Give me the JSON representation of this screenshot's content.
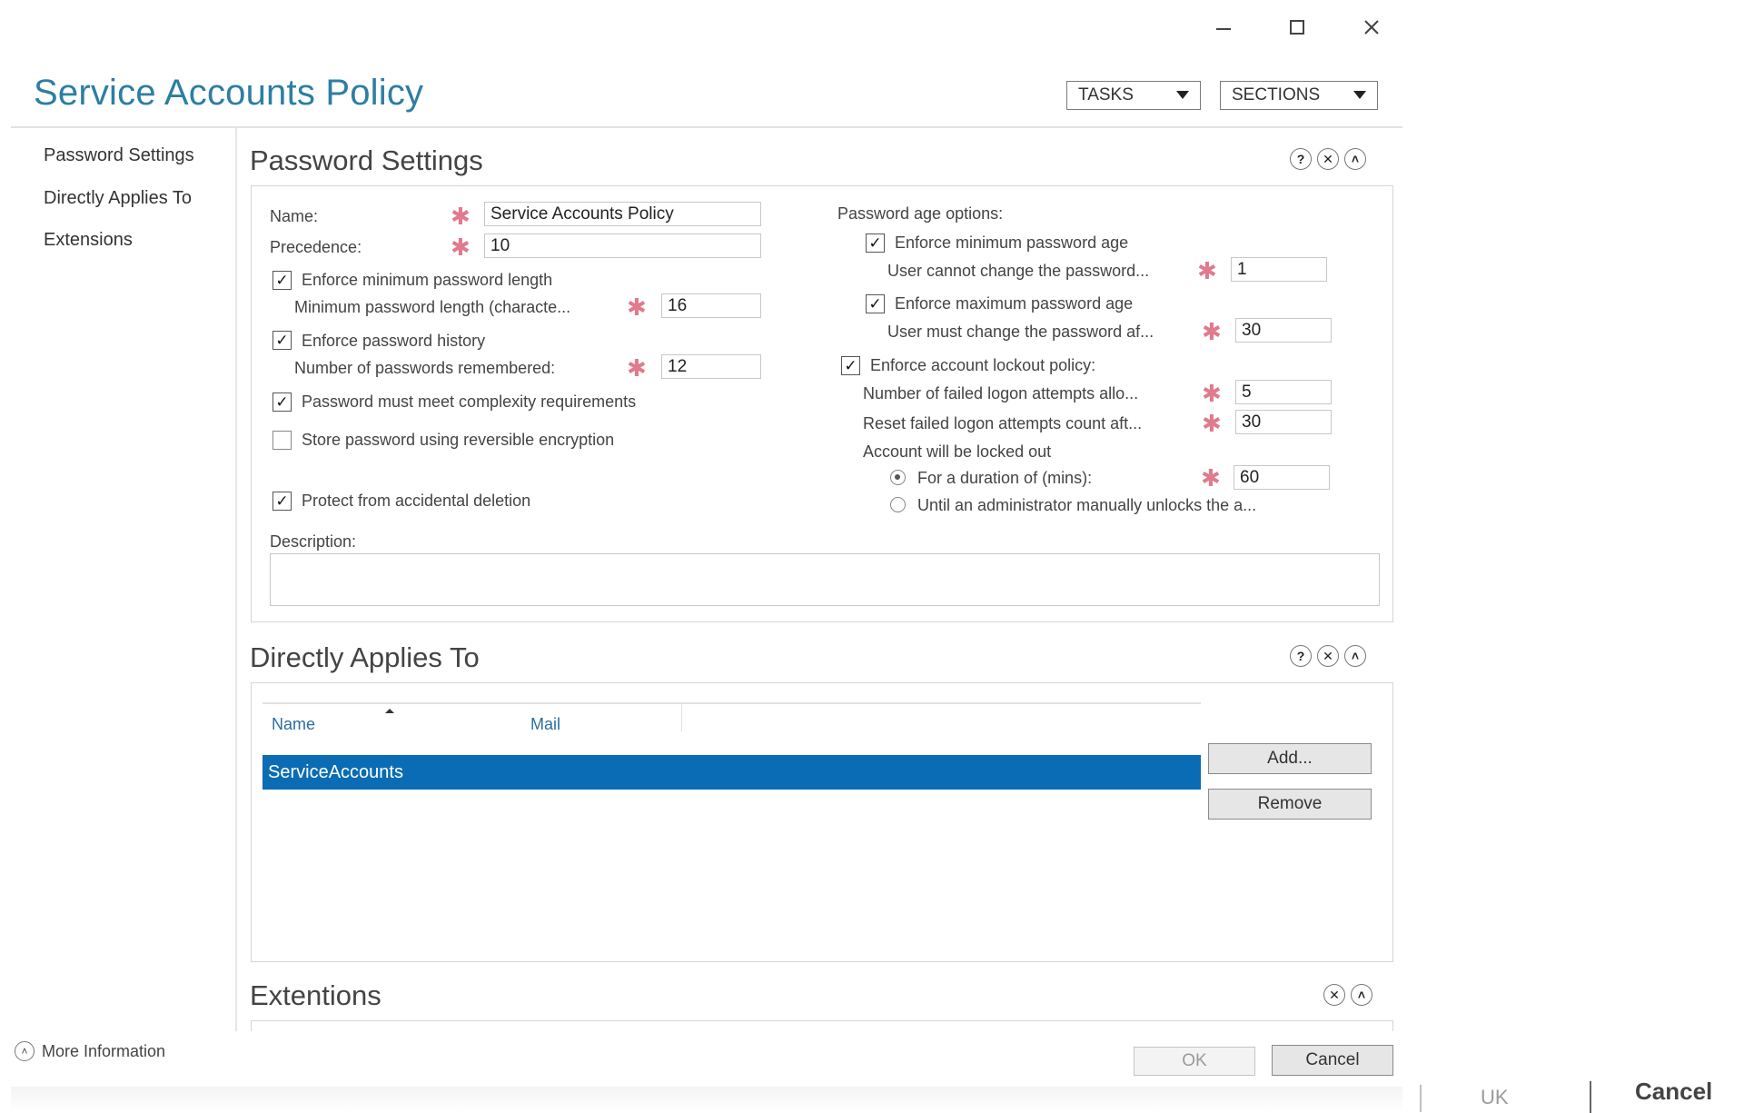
{
  "window": {
    "minimize_icon": "minimize-icon",
    "maximize_icon": "maximize-icon",
    "close_icon": "close-icon"
  },
  "app_title": "Service Accounts Policy",
  "header": {
    "tasks_label": "TASKS",
    "sections_label": "SECTIONS"
  },
  "nav": {
    "items": [
      "Password Settings",
      "Directly Applies To",
      "Extensions"
    ]
  },
  "password_settings": {
    "title": "Password Settings",
    "name_label": "Name:",
    "name_value": "Service Accounts Policy",
    "precedence_label": "Precedence:",
    "precedence_value": "10",
    "enforce_min_len_label": "Enforce minimum password length",
    "enforce_min_len_checked": true,
    "min_len_label": "Minimum password length (characte...",
    "min_len_value": "16",
    "enforce_history_label": "Enforce password history",
    "enforce_history_checked": true,
    "remembered_label": "Number of passwords remembered:",
    "remembered_value": "12",
    "complexity_label": "Password must meet complexity requirements",
    "complexity_checked": true,
    "reversible_label": "Store password using reversible encryption",
    "reversible_checked": false,
    "protect_label": "Protect from accidental deletion",
    "protect_checked": true,
    "description_label": "Description:",
    "description_value": "",
    "age_options_label": "Password age options:",
    "enforce_min_age_label": "Enforce minimum password age",
    "enforce_min_age_checked": true,
    "min_age_label": "User cannot change the password...",
    "min_age_value": "1",
    "enforce_max_age_label": "Enforce maximum password age",
    "enforce_max_age_checked": true,
    "max_age_label": "User must change the password af...",
    "max_age_value": "30",
    "lockout_label": "Enforce account lockout policy:",
    "lockout_checked": true,
    "failed_attempts_label": "Number of failed logon attempts allo...",
    "failed_attempts_value": "5",
    "reset_count_label": "Reset failed logon attempts count aft...",
    "reset_count_value": "30",
    "locked_out_label": "Account will be locked out",
    "duration_label": "For a duration of (mins):",
    "duration_value": "60",
    "duration_selected": true,
    "until_admin_label": "Until an administrator manually unlocks the a..."
  },
  "directly_applies_to": {
    "title": "Directly Applies To",
    "columns": [
      "Name",
      "Mail"
    ],
    "rows": [
      {
        "name": "ServiceAccounts",
        "mail": ""
      }
    ],
    "add_label": "Add...",
    "remove_label": "Remove"
  },
  "extensions": {
    "title": "Extentions"
  },
  "footer": {
    "more_info_label": "More Information",
    "ok_label": "OK",
    "cancel_label": "Cancel",
    "ghost_ok": "UK",
    "ghost_cancel": "Cancel"
  }
}
